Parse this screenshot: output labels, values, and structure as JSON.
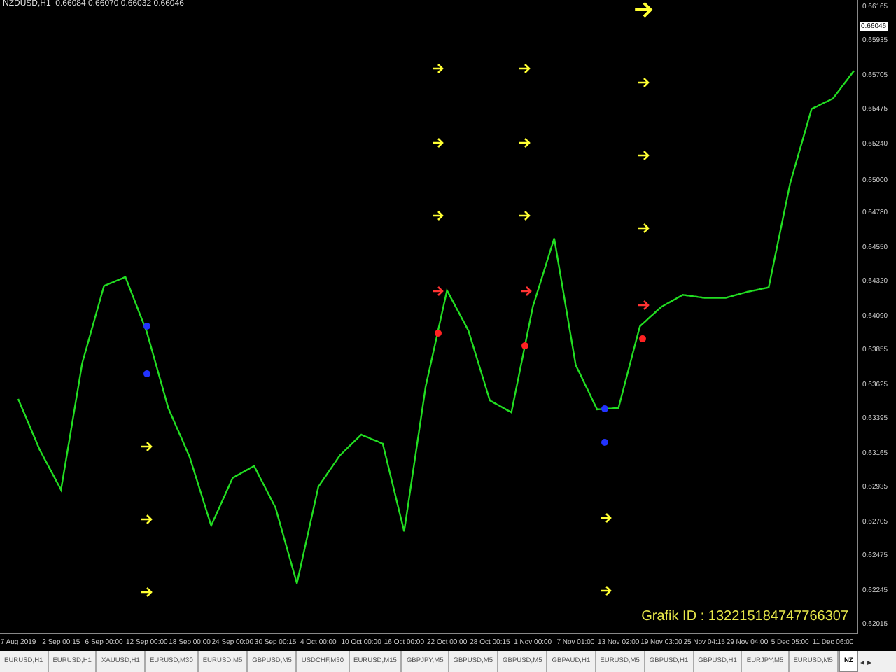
{
  "chart_window": {
    "title": "NZDUSD,H1  0.66084 0.66070 0.66032 0.66046",
    "grafik_id": "Grafik ID : 132215184747766307",
    "current_price": "0.66046",
    "chart_data": {
      "type": "line",
      "ylim": [
        0.61959,
        0.66212
      ],
      "categories": [
        "7 Aug 2019",
        null,
        "2 Sep 00:15",
        null,
        "6 Sep 00:00",
        null,
        "12 Sep 00:00",
        null,
        "18 Sep 00:00",
        null,
        "24 Sep 00:00",
        null,
        "30 Sep 00:15",
        null,
        "4 Oct 00:00",
        null,
        "10 Oct 00:00",
        null,
        "16 Oct 00:00",
        null,
        "22 Oct 00:00",
        null,
        "28 Oct 00:15",
        null,
        "1 Nov 00:00",
        null,
        "7 Nov 01:00",
        null,
        "13 Nov 02:00",
        null,
        "19 Nov 03:00",
        null,
        "25 Nov 04:15",
        null,
        "29 Nov 04:00",
        null,
        "5 Dec 05:00",
        null,
        "11 Dec 06:00",
        null
      ],
      "series": [
        {
          "color": "#22dd22",
          "values": [
            0.6353,
            0.6319,
            0.6292,
            0.6378,
            0.6429,
            0.6435,
            0.6398,
            0.6347,
            0.6314,
            0.6268,
            0.63,
            0.6308,
            0.628,
            0.6229,
            0.6294,
            0.6315,
            0.6329,
            0.6323,
            0.6264,
            0.6361,
            0.6426,
            0.6399,
            0.6352,
            0.6344,
            0.6415,
            0.6461,
            0.6376,
            0.6346,
            0.6347,
            0.6402,
            0.6415,
            0.6423,
            0.6421,
            0.6421,
            0.6425,
            0.6428,
            0.6498,
            0.6548,
            0.6555,
            0.6574
          ]
        }
      ],
      "yticks": [
        {
          "value": 0.66165,
          "label": "0.66165"
        },
        {
          "value": 0.65935,
          "label": "0.65935"
        },
        {
          "value": 0.65705,
          "label": "0.65705"
        },
        {
          "value": 0.65475,
          "label": "0.65475"
        },
        {
          "value": 0.6524,
          "label": "0.65240"
        },
        {
          "value": 0.65,
          "label": "0.65000"
        },
        {
          "value": 0.6478,
          "label": "0.64780"
        },
        {
          "value": 0.6455,
          "label": "0.64550"
        },
        {
          "value": 0.6432,
          "label": "0.64320"
        },
        {
          "value": 0.6409,
          "label": "0.64090"
        },
        {
          "value": 0.63855,
          "label": "0.63855"
        },
        {
          "value": 0.63625,
          "label": "0.63625"
        },
        {
          "value": 0.63395,
          "label": "0.63395"
        },
        {
          "value": 0.63165,
          "label": "0.63165"
        },
        {
          "value": 0.62935,
          "label": "0.62935"
        },
        {
          "value": 0.62705,
          "label": "0.62705"
        },
        {
          "value": 0.62475,
          "label": "0.62475"
        },
        {
          "value": 0.62245,
          "label": "0.62245"
        },
        {
          "value": 0.62015,
          "label": "0.62015"
        }
      ]
    }
  },
  "tabs": [
    {
      "label": "EURUSD,H1",
      "selected": false
    },
    {
      "label": "EURUSD,H1",
      "selected": false
    },
    {
      "label": "XAUUSD,H1",
      "selected": false
    },
    {
      "label": "EURUSD,M30",
      "selected": false
    },
    {
      "label": "EURUSD,M5",
      "selected": false
    },
    {
      "label": "GBPUSD,M5",
      "selected": false
    },
    {
      "label": "USDCHF,M30",
      "selected": false
    },
    {
      "label": "EURUSD,M15",
      "selected": false
    },
    {
      "label": "GBPJPY,M5",
      "selected": false
    },
    {
      "label": "GBPUSD,M5",
      "selected": false
    },
    {
      "label": "GBPUSD,M5",
      "selected": false
    },
    {
      "label": "GBPAUD,H1",
      "selected": false
    },
    {
      "label": "EURUSD,M5",
      "selected": false
    },
    {
      "label": "GBPUSD,H1",
      "selected": false
    },
    {
      "label": "GBPUSD,H1",
      "selected": false
    },
    {
      "label": "EURJPY,M5",
      "selected": false
    },
    {
      "label": "EURUSD,M5",
      "selected": false
    },
    {
      "label": "NZ",
      "selected": true
    }
  ],
  "tab_scroll": [
    "◂",
    "▸"
  ]
}
